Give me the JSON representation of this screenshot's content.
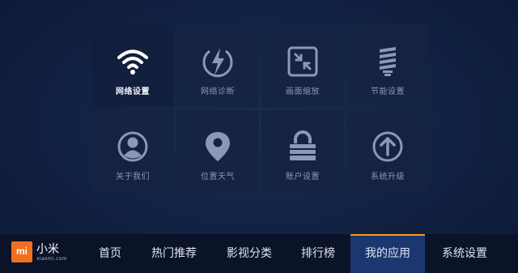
{
  "settings_tiles": [
    {
      "label": "网络设置",
      "icon": "wifi-icon",
      "selected": true
    },
    {
      "label": "网络诊断",
      "icon": "lightning-icon",
      "selected": false
    },
    {
      "label": "画面缩放",
      "icon": "shrink-icon",
      "selected": false
    },
    {
      "label": "节能设置",
      "icon": "energy-bulb-icon",
      "selected": false
    },
    {
      "label": "关于我们",
      "icon": "user-icon",
      "selected": false
    },
    {
      "label": "位置天气",
      "icon": "location-pin-icon",
      "selected": false
    },
    {
      "label": "账户设置",
      "icon": "lock-icon",
      "selected": false
    },
    {
      "label": "系统升级",
      "icon": "upgrade-arrow-icon",
      "selected": false
    }
  ],
  "brand": {
    "logo_text": "mi",
    "name": "小米",
    "domain": "xiaomi.com"
  },
  "nav": {
    "items": [
      "首页",
      "热门推荐",
      "影视分类",
      "排行榜",
      "我的应用",
      "系统设置"
    ],
    "active_index": 4
  },
  "colors": {
    "accent": "#f39a1e",
    "logo": "#f0701f",
    "active_tab": "#1c3670"
  }
}
